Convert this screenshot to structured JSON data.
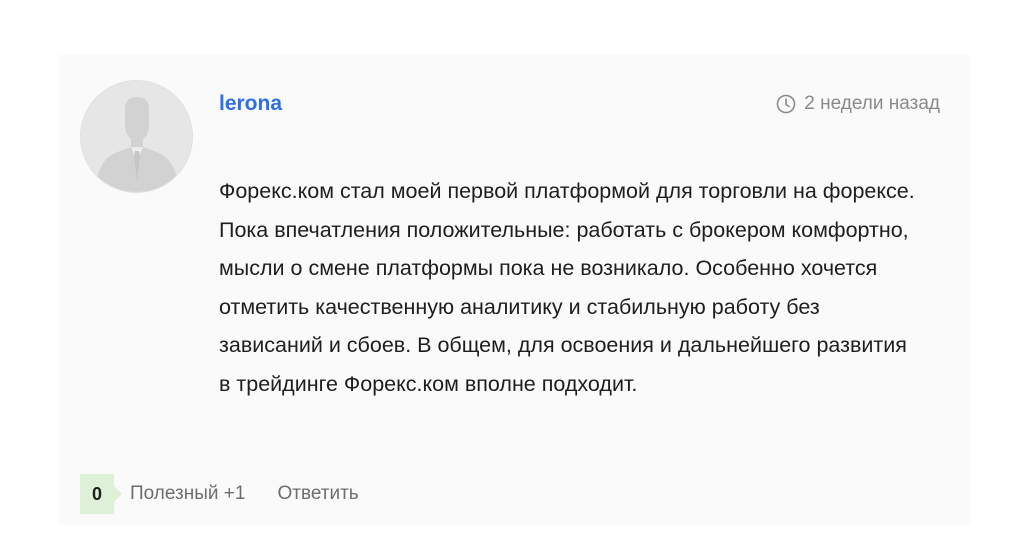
{
  "comment": {
    "author": "lerona",
    "time": "2 недели назад",
    "text": "Форекс.ком стал моей первой платформой для торговли на форексе. Пока впечатления положительные: работать с брокером комфортно, мысли о смене платформы пока не возникало. Особенно хочется отметить качественную аналитику и стабильную работу без зависаний и сбоев. В общем, для освоения и дальнейшего развития в трейдинге Форекс.ком вполне подходит.",
    "avatar_icon": "user-silhouette-icon",
    "time_icon": "clock-icon"
  },
  "actions": {
    "vote_count": "0",
    "useful_label": "Полезный +1",
    "reply_label": "Ответить"
  },
  "colors": {
    "author_link": "#2f6fe0",
    "vote_background": "#dff0d8",
    "card_background": "#fafafa"
  }
}
